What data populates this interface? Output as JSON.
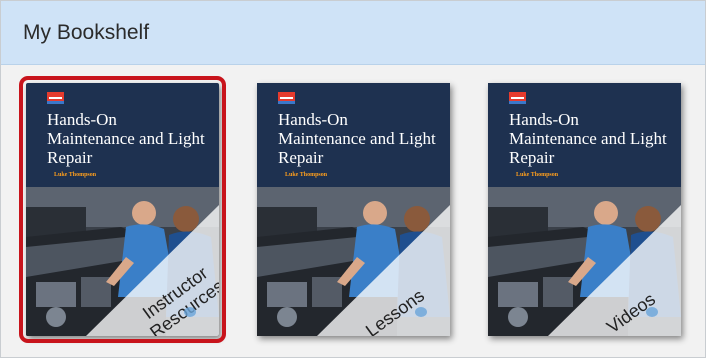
{
  "header": {
    "title": "My Bookshelf"
  },
  "books": [
    {
      "title": "Hands-On Maintenance and Light Repair",
      "author": "Luke Thompson",
      "badge": "Instructor Resources",
      "selected": true
    },
    {
      "title": "Hands-On Maintenance and Light Repair",
      "author": "Luke Thompson",
      "badge": "Lessons",
      "selected": false
    },
    {
      "title": "Hands-On Maintenance and Light Repair",
      "author": "Luke Thompson",
      "badge": "Videos",
      "selected": false
    }
  ],
  "colors": {
    "header_background": "#cfe3f7",
    "cover_navy": "#1e3150",
    "selection_outline": "#c8141c",
    "author_text": "#ff9f1c"
  },
  "icons": {
    "publisher_logo": "publisher-logo-icon",
    "site_logo": "site-logo-icon"
  }
}
